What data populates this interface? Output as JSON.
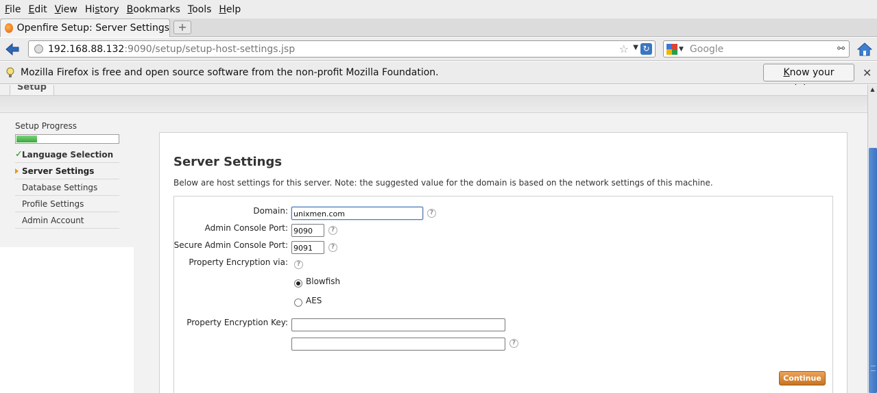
{
  "menu": [
    "File",
    "Edit",
    "View",
    "History",
    "Bookmarks",
    "Tools",
    "Help"
  ],
  "menu_access": [
    "F",
    "E",
    "V",
    "s",
    "B",
    "T",
    "H"
  ],
  "tab": {
    "title": "Openfire Setup: Server Settings",
    "new_tab": "+"
  },
  "address": {
    "host": "192.168.88.132",
    "path": ":9090/setup/setup-host-settings.jsp"
  },
  "search": {
    "placeholder": "Google"
  },
  "notification": {
    "text": "Mozilla Firefox is free and open source software from the non-profit Mozilla Foundation.",
    "button": "Know your rights...",
    "close": "✕"
  },
  "page_tab": {
    "label": "Setup"
  },
  "sidebar": {
    "title": "Setup Progress",
    "progress_fraction": 0.2,
    "items": [
      {
        "label": "Language Selection",
        "state": "done"
      },
      {
        "label": "Server Settings",
        "state": "active"
      },
      {
        "label": "Database Settings",
        "state": "pending"
      },
      {
        "label": "Profile Settings",
        "state": "pending"
      },
      {
        "label": "Admin Account",
        "state": "pending"
      }
    ]
  },
  "main": {
    "heading": "Server Settings",
    "description": "Below are host settings for this server. Note: the suggested value for the domain is based on the network settings of this machine.",
    "fields": {
      "domain_label": "Domain:",
      "domain_value": "unixmen.com",
      "admin_port_label": "Admin Console Port:",
      "admin_port_value": "9090",
      "secure_port_label": "Secure Admin Console Port:",
      "secure_port_value": "9091",
      "encryption_via_label": "Property Encryption via:",
      "option_blowfish": "Blowfish",
      "option_aes": "AES",
      "selected_option": "Blowfish",
      "encryption_key_label": "Property Encryption Key:",
      "encryption_key_value": "",
      "encryption_key_confirm_value": ""
    },
    "help_glyph": "?",
    "continue_label": "Continue"
  },
  "colors": {
    "progress": "#3aa83a",
    "continue_button": "#c8741f",
    "check": "#2a8a2a"
  }
}
